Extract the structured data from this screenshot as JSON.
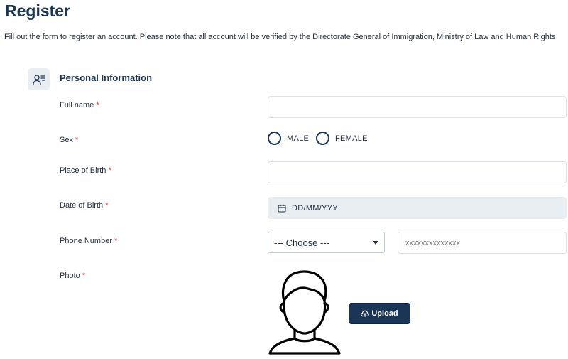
{
  "page": {
    "title": "Register",
    "description": "Fill out the form to register an account. Please note that all account will be verified by the Directorate General of Immigration, Ministry of Law and Human Rights"
  },
  "section": {
    "title": "Personal Information",
    "icon": "user-list-icon"
  },
  "form": {
    "required_mark": "*",
    "full_name": {
      "label": "Full name",
      "value": "",
      "placeholder": ""
    },
    "sex": {
      "label": "Sex",
      "options": [
        "MALE",
        "FEMALE"
      ],
      "selected": null
    },
    "place_of_birth": {
      "label": "Place of Birth",
      "value": "",
      "placeholder": ""
    },
    "date_of_birth": {
      "label": "Date of Birth",
      "placeholder": "DD/MM/YYY",
      "icon": "calendar-icon"
    },
    "phone_number": {
      "label": "Phone Number",
      "code_select": {
        "selected": "--- Choose ---"
      },
      "placeholder": "xxxxxxxxxxxxxx"
    },
    "photo": {
      "label": "Photo",
      "avatar_icon": "person-avatar-icon",
      "upload_label": "Upload",
      "upload_icon": "cloud-upload-icon"
    }
  },
  "colors": {
    "primary": "#1a3556",
    "required": "#d63a3a",
    "field_disabled_bg": "#e9eef3",
    "border": "#dde3ea"
  }
}
